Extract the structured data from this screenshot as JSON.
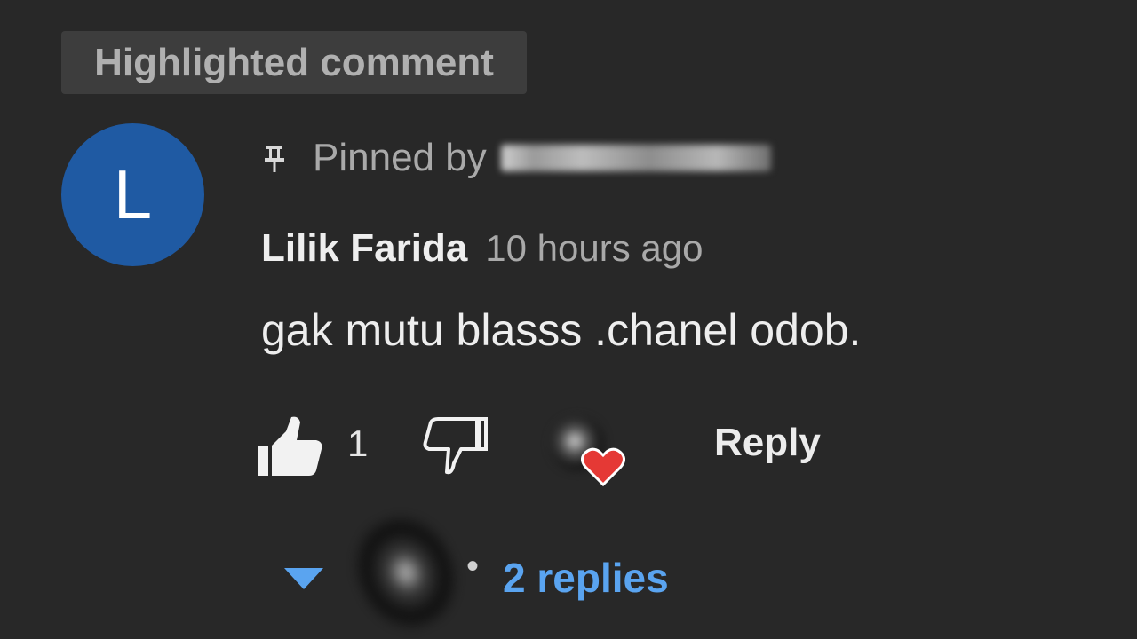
{
  "badge": {
    "label": "Highlighted comment"
  },
  "comment": {
    "avatar_initial": "L",
    "avatar_color": "#1f5aa3",
    "pinned_label": "Pinned by",
    "pinned_icon": "pin-icon",
    "author": "Lilik Farida",
    "timestamp": "10 hours ago",
    "text": "gak mutu blasss .chanel odob."
  },
  "actions": {
    "like_icon": "thumbs-up-icon",
    "like_count": "1",
    "dislike_icon": "thumbs-down-icon",
    "creator_heart_icon": "heart-icon",
    "heart_color": "#e53935",
    "reply_label": "Reply"
  },
  "replies": {
    "expand_icon": "caret-down-icon",
    "separator": "•",
    "label": "2 replies",
    "link_color": "#5aa4f0"
  }
}
